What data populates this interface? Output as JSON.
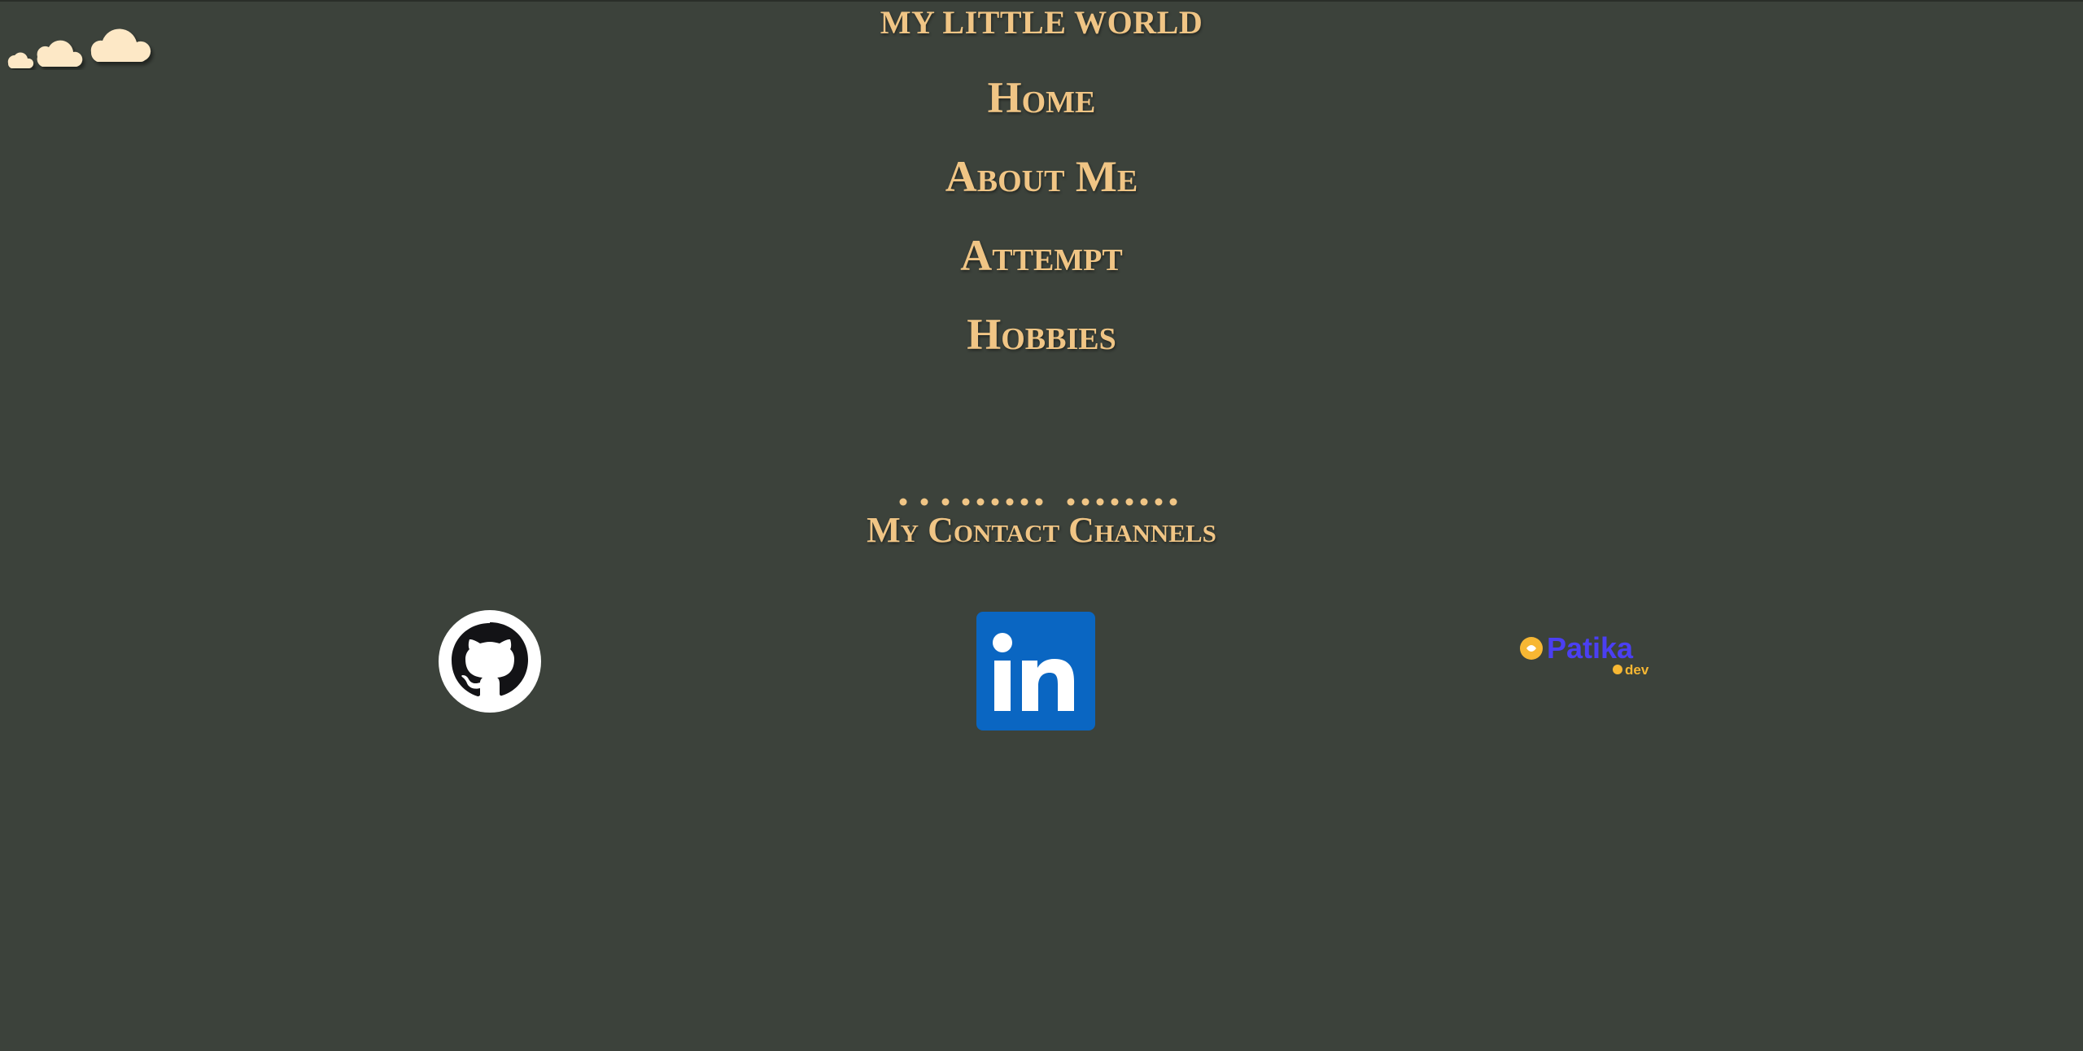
{
  "header": {
    "title": "MY LITTLE WORLD"
  },
  "nav": {
    "items": [
      {
        "label": "Home"
      },
      {
        "label": "About Me"
      },
      {
        "label": "Attempt"
      },
      {
        "label": "Hobbies"
      }
    ]
  },
  "contact": {
    "heading": "My Contact Channels",
    "links": [
      {
        "name": "github",
        "icon": "github-icon"
      },
      {
        "name": "linkedin",
        "icon": "linkedin-icon",
        "text": "in"
      },
      {
        "name": "patika",
        "icon": "patika-logo",
        "text": "Patika",
        "subtext": "dev"
      }
    ]
  },
  "colors": {
    "background": "#3c423b",
    "accent": "#f0c585",
    "cloud": "#fde8c6",
    "linkedin": "#0a66c2",
    "patika_blue": "#4b3ff2",
    "patika_orange": "#f7b733"
  }
}
